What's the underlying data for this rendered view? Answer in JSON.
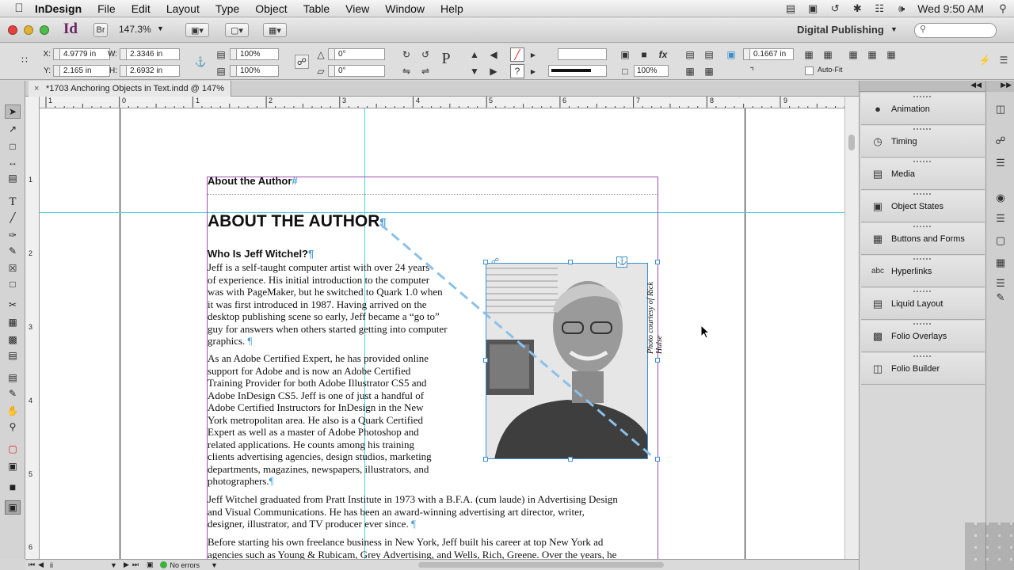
{
  "menubar": {
    "app_name": "InDesign",
    "items": [
      "File",
      "Edit",
      "Layout",
      "Type",
      "Object",
      "Table",
      "View",
      "Window",
      "Help"
    ],
    "clock": "Wed 9:50 AM"
  },
  "appbar": {
    "logo": "Id",
    "bridge": "Br",
    "zoom": "147.3%",
    "workspace": "Digital Publishing",
    "search_placeholder": ""
  },
  "control": {
    "x_label": "X:",
    "x_value": "4.9779 in",
    "y_label": "Y:",
    "y_value": "2.165 in",
    "w_label": "W:",
    "w_value": "2.3346 in",
    "h_label": "H:",
    "h_value": "2.6932 in",
    "scale_x": "100%",
    "scale_y": "100%",
    "rotate": "0°",
    "shear": "0°",
    "stroke_pct": "100%",
    "offset": "0.1667 in",
    "autofit": "Auto-Fit"
  },
  "tab": {
    "title": "*1703 Anchoring Objects in Text.indd @ 147%"
  },
  "ruler": {
    "h_ticks": [
      "1",
      "0",
      "1",
      "2",
      "3",
      "4",
      "5",
      "6",
      "7",
      "8",
      "9"
    ],
    "v_ticks": [
      "1",
      "2",
      "3",
      "4",
      "5",
      "6"
    ]
  },
  "document": {
    "running_head": "About the Author",
    "heading": "ABOUT THE AUTHOR",
    "subheading": "Who Is Jeff Witchel?",
    "p1_lines": [
      "Jeff is a self-taught computer artist with over 24 years",
      "of experience. His initial introduction to the computer",
      "was with PageMaker, but he switched to Quark 1.0 when",
      "it was first introduced in 1987. Having arrived on the",
      "desktop publishing scene so early, Jeff became a “go to”",
      "guy for answers when others started getting into computer",
      "graphics."
    ],
    "p2_lines": [
      "As an Adobe Certified Expert, he has provided online",
      "support for Adobe and is now an Adobe Certified",
      "Training Provider for both Adobe Illustrator CS5 and",
      "Adobe InDesign CS5. Jeff is one of just a handful of",
      "Adobe Certified Instructors for InDesign in the New",
      "York metropolitan area. He also is a Quark Certified",
      "Expert as well as a master of Adobe Photoshop and",
      "related applications. He counts among his training",
      "clients advertising agencies, design studios, marketing",
      "departments, magazines, newspapers, illustrators, and",
      "photographers."
    ],
    "p3_lines": [
      "Jeff Witchel graduated from Pratt Institute in 1973 with a B.F.A. (cum laude) in Advertising Design",
      "and Visual Communications. He has been an award-winning advertising art director, writer,",
      "designer, illustrator, and TV producer ever since."
    ],
    "p4_lines": [
      "Before starting his own freelance business in New York, Jeff built his career at top New York ad",
      "agencies such as Young & Rubicam, Grey Advertising, and Wells, Rich, Greene. Over the years, he"
    ],
    "photo_credit": "Photo courtesy of Rick Hulse"
  },
  "panels": [
    {
      "label": "Animation",
      "icon": "animation-icon"
    },
    {
      "label": "Timing",
      "icon": "timing-icon"
    },
    {
      "label": "Media",
      "icon": "media-icon"
    },
    {
      "label": "Object States",
      "icon": "object-states-icon"
    },
    {
      "label": "Buttons and Forms",
      "icon": "buttons-forms-icon"
    },
    {
      "label": "Hyperlinks",
      "icon": "hyperlinks-icon"
    },
    {
      "label": "Liquid Layout",
      "icon": "liquid-layout-icon"
    },
    {
      "label": "Folio Overlays",
      "icon": "folio-overlays-icon"
    },
    {
      "label": "Folio Builder",
      "icon": "folio-builder-icon"
    }
  ],
  "statusbar": {
    "page": "ii",
    "preflight": "No errors"
  },
  "colors": {
    "frame": "#a24fb0",
    "guide": "#4fd0d8",
    "selection": "#3c8fd0"
  }
}
